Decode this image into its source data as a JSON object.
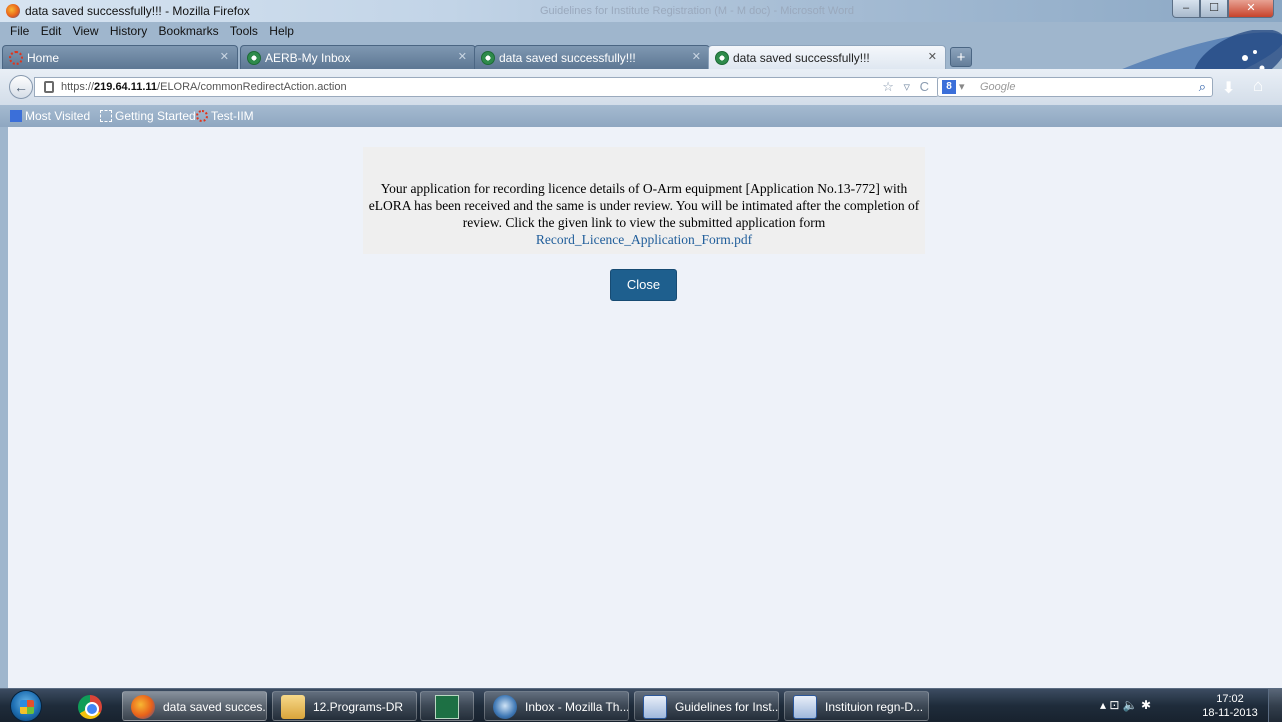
{
  "window": {
    "title": "data saved successfully!!! - Mozilla Firefox",
    "background_title": "Guidelines for Institute Registration (M - M doc) - Microsoft Word",
    "controls": {
      "minimize": "–",
      "maximize": "☐",
      "close": "✕"
    }
  },
  "menu": {
    "items": [
      "File",
      "Edit",
      "View",
      "History",
      "Bookmarks",
      "Tools",
      "Help"
    ]
  },
  "tabs": [
    {
      "label": "Home",
      "icon": "red-dotted-icon",
      "active": false
    },
    {
      "label": "AERB-My Inbox",
      "icon": "green-globe-icon",
      "active": false
    },
    {
      "label": "data saved successfully!!!",
      "icon": "green-globe-icon",
      "active": false
    },
    {
      "label": "data saved successfully!!!",
      "icon": "green-globe-icon",
      "active": true
    }
  ],
  "new_tab": "+",
  "nav": {
    "back": "←",
    "url_prefix": "https://",
    "url_host": "219.64.11.11",
    "url_path": "/ELORA/commonRedirectAction.action",
    "url_icons": "☆ ▿ C",
    "search_engine": "8",
    "search_placeholder": "Google",
    "search_icon": "⌕",
    "download_icon": "⬇",
    "home_icon": "⌂"
  },
  "bookmarks": {
    "items": [
      "Most Visited",
      "Getting Started",
      "Test-IIM"
    ]
  },
  "message": {
    "text": "Your application for recording licence details of O-Arm equipment [Application No.13-772] with eLORA has been received and the same is under review. You will be intimated after the completion of review. Click the given link to view the submitted application form",
    "link": "Record_Licence_Application_Form.pdf"
  },
  "close_button": "Close",
  "taskbar": {
    "tasks": [
      {
        "label": "data saved succes...",
        "icon": "firefox-icon"
      },
      {
        "label": "12.Programs-DR",
        "icon": "folder-icon"
      },
      {
        "label": "Inbox - Mozilla Th...",
        "icon": "thunderbird-icon"
      },
      {
        "label": "Guidelines for Inst...",
        "icon": "word-icon"
      },
      {
        "label": "Instituion regn-D...",
        "icon": "word-icon"
      }
    ],
    "tray_icons": "▴ ⊡ 🔈 ✱",
    "time": "17:02",
    "date": "18-11-2013"
  }
}
